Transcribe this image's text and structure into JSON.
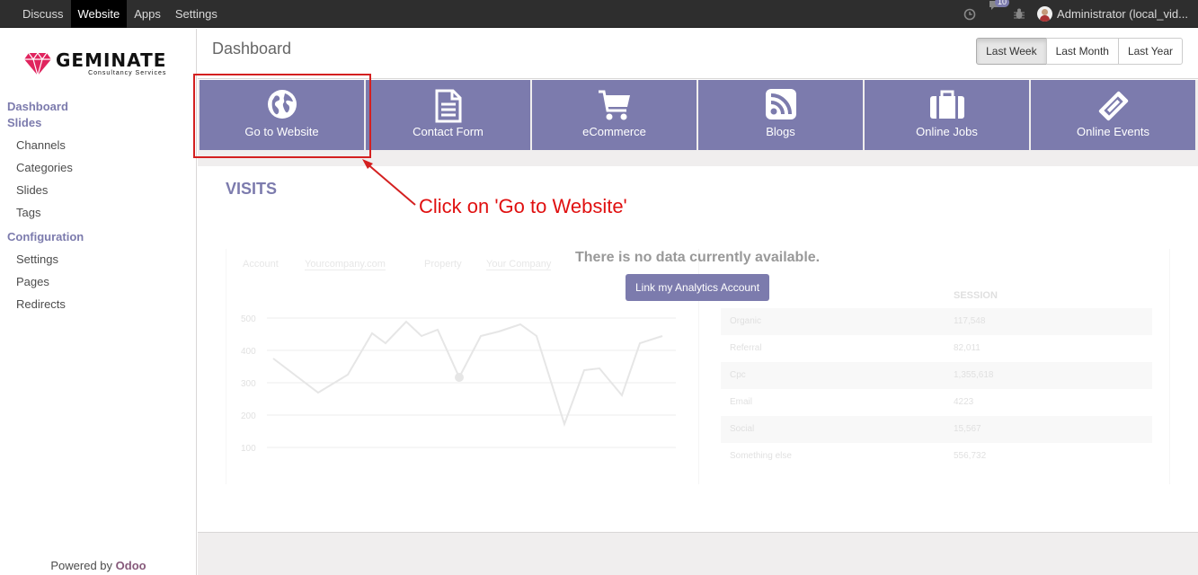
{
  "topbar": {
    "menu": [
      {
        "label": "Discuss",
        "active": false
      },
      {
        "label": "Website",
        "active": true
      },
      {
        "label": "Apps",
        "active": false
      },
      {
        "label": "Settings",
        "active": false
      }
    ],
    "message_count": "10",
    "user_name": "Administrator (local_vid..."
  },
  "sidebar": {
    "logo_name": "GEMINATE",
    "logo_tagline": "Consultancy Services",
    "sections": [
      {
        "heading": "Dashboard",
        "items": []
      },
      {
        "heading": "Slides",
        "items": [
          "Channels",
          "Categories",
          "Slides",
          "Tags"
        ]
      },
      {
        "heading": "Configuration",
        "items": [
          "Settings",
          "Pages",
          "Redirects"
        ]
      }
    ],
    "powered_prefix": "Powered by",
    "powered_brand": "Odoo"
  },
  "control_panel": {
    "title": "Dashboard",
    "range_buttons": [
      {
        "label": "Last Week",
        "active": true
      },
      {
        "label": "Last Month",
        "active": false
      },
      {
        "label": "Last Year",
        "active": false
      }
    ]
  },
  "tiles": [
    {
      "label": "Go to Website",
      "icon": "globe-icon"
    },
    {
      "label": "Contact Form",
      "icon": "document-icon"
    },
    {
      "label": "eCommerce",
      "icon": "cart-icon"
    },
    {
      "label": "Blogs",
      "icon": "rss-icon"
    },
    {
      "label": "Online Jobs",
      "icon": "briefcase-icon"
    },
    {
      "label": "Online Events",
      "icon": "ticket-icon"
    }
  ],
  "visits": {
    "heading": "VISITS",
    "no_data_message": "There is no data currently available.",
    "link_button": "Link my Analytics Account",
    "placeholder": {
      "account_label": "Account",
      "account_value": "Yourcompany.com",
      "property_label": "Property",
      "property_value": "Your Company",
      "y_ticks": [
        "500",
        "400",
        "300",
        "200",
        "100"
      ],
      "table_header": "SESSION",
      "table_rows": [
        {
          "source": "Organic",
          "sessions": "117,548"
        },
        {
          "source": "Referral",
          "sessions": "82,011"
        },
        {
          "source": "Cpc",
          "sessions": "1,355,618"
        },
        {
          "source": "Email",
          "sessions": "4223"
        },
        {
          "source": "Social",
          "sessions": "15,567"
        },
        {
          "source": "Something else",
          "sessions": "556,732"
        }
      ]
    }
  },
  "annotation": {
    "callout_text": "Click on 'Go to Website'",
    "color": "#e01010"
  },
  "colors": {
    "brand": "#7c7bad",
    "topbar": "#2e2e2e"
  }
}
